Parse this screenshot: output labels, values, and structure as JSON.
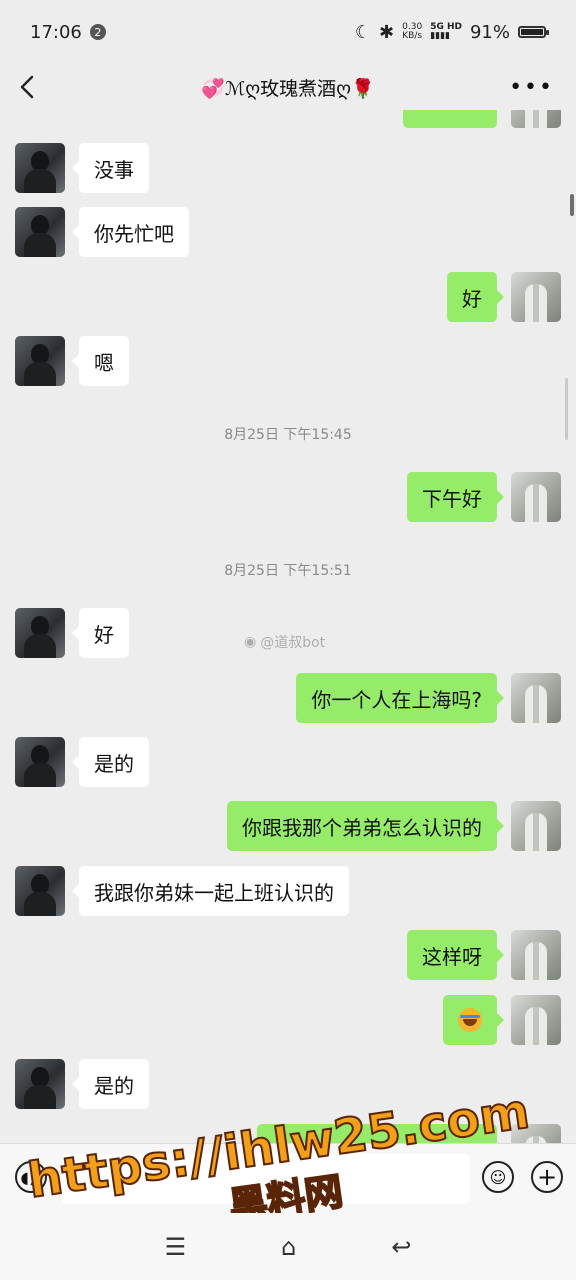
{
  "status_bar": {
    "time": "17:06",
    "notification_count": "2",
    "net_speed_value": "0.30",
    "net_speed_unit": "KB/s",
    "network_type": "5G HD",
    "battery_percent": "91%",
    "battery_level": 0.91
  },
  "header": {
    "title": "💞ℳღ玫瑰煮酒ღ🌹"
  },
  "chat": {
    "messages": [
      {
        "side": "right",
        "text": ""
      },
      {
        "side": "left",
        "text": "没事"
      },
      {
        "side": "left",
        "text": "你先忙吧"
      },
      {
        "side": "right",
        "text": "好"
      },
      {
        "side": "left",
        "text": "嗯"
      },
      {
        "type": "timestamp",
        "text": "8月25日 下午15:45"
      },
      {
        "side": "right",
        "text": "下午好"
      },
      {
        "type": "timestamp",
        "text": "8月25日 下午15:51"
      },
      {
        "side": "left",
        "text": "好"
      },
      {
        "side": "right",
        "text": "你一个人在上海吗?"
      },
      {
        "side": "left",
        "text": "是的"
      },
      {
        "side": "right",
        "text": "你跟我那个弟弟怎么认识的"
      },
      {
        "side": "left",
        "text": "我跟你弟妹一起上班认识的"
      },
      {
        "side": "right",
        "text": "这样呀"
      },
      {
        "side": "right",
        "text": "",
        "icon": "crying-laughing-face-icon"
      },
      {
        "side": "left",
        "text": "是的"
      },
      {
        "side": "right",
        "text": ""
      }
    ],
    "watermark": "@道叔bot"
  },
  "input_bar": {
    "text_value": "",
    "voice_icon": "voice-icon",
    "emoji_icon": "emoji-icon",
    "plus_icon": "plus-icon"
  },
  "overlay": {
    "url": "https://ihlw25.com",
    "caption": "黑料网"
  },
  "bottom_nav": {
    "menu_icon": "menu-icon",
    "home_icon": "home-icon",
    "back_icon": "back-icon"
  },
  "colors": {
    "bubble_green": "#95ec69",
    "bubble_white": "#ffffff",
    "background": "#ededed",
    "stamp_orange": "#f2a019"
  }
}
